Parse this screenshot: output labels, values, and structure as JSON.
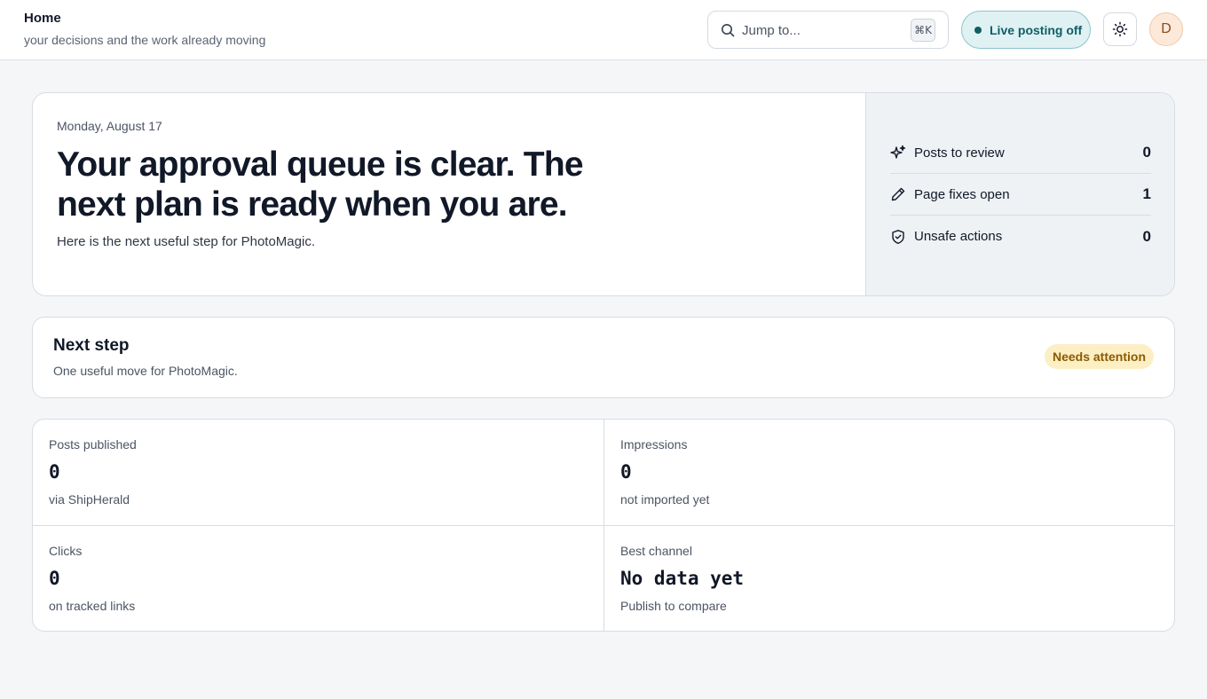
{
  "header": {
    "title": "Home",
    "subtitle": "your decisions and the work already moving",
    "search": {
      "placeholder": "Jump to...",
      "shortcut": "⌘K"
    },
    "live_posting_label": "Live posting off",
    "avatar_initial": "D"
  },
  "hero": {
    "date": "Monday, August 17",
    "headline": "Your approval queue is clear. The next plan is ready when you are.",
    "description": "Here is the next useful step for PhotoMagic.",
    "stats": [
      {
        "icon": "sparkles-icon",
        "label": "Posts to review",
        "value": "0"
      },
      {
        "icon": "pencil-icon",
        "label": "Page fixes open",
        "value": "1"
      },
      {
        "icon": "shield-icon",
        "label": "Unsafe actions",
        "value": "0"
      }
    ]
  },
  "next_step": {
    "title": "Next step",
    "subtitle": "One useful move for PhotoMagic.",
    "badge": "Needs attention"
  },
  "metrics": [
    {
      "label": "Posts published",
      "value": "0",
      "note": "via ShipHerald"
    },
    {
      "label": "Impressions",
      "value": "0",
      "note": "not imported yet"
    },
    {
      "label": "Clicks",
      "value": "0",
      "note": "on tracked links"
    },
    {
      "label": "Best channel",
      "value": "No data yet",
      "note": "Publish to compare"
    }
  ],
  "colors": {
    "accent_teal": "#0f5e66",
    "badge_bg": "#fdefc4",
    "badge_text": "#8a5a00",
    "avatar_bg": "#fde9d9"
  }
}
